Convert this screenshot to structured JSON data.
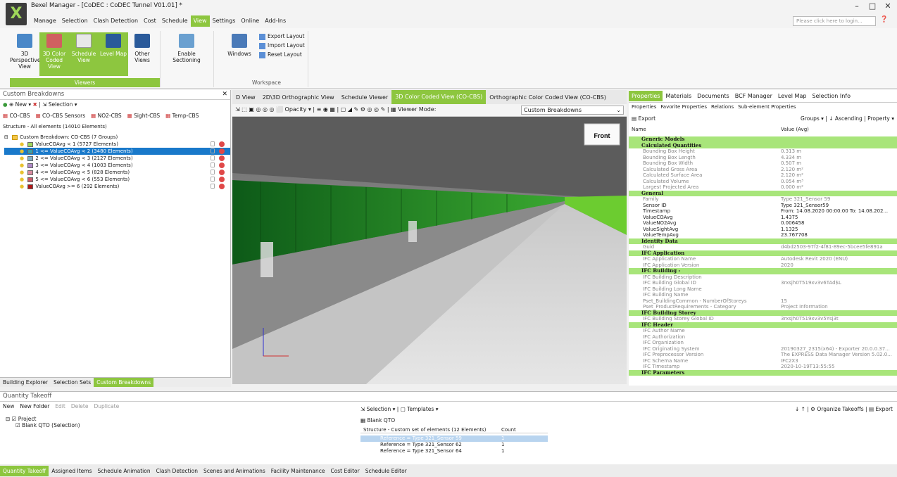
{
  "window": {
    "title": "Bexel Manager - [CoDEC : CoDEC Tunnel V01.01] *",
    "login_placeholder": "Please click here to login...",
    "min": "–",
    "max": "□",
    "close": "✕"
  },
  "menu": [
    "Manage",
    "Selection",
    "Clash Detection",
    "Cost",
    "Schedule",
    "View",
    "Settings",
    "Online",
    "Add-Ins"
  ],
  "ribbon": {
    "viewers": [
      {
        "label": "3D Perspective View"
      },
      {
        "label": "3D Color Coded View"
      },
      {
        "label": "Schedule View"
      },
      {
        "label": "Level Map"
      },
      {
        "label": "Other Views"
      },
      {
        "label": "Enable Sectioning"
      }
    ],
    "viewers_group": "Viewers",
    "windows_label": "Windows",
    "layout": [
      "Export Layout",
      "Import Layout",
      "Reset Layout"
    ],
    "workspace_group": "Workspace"
  },
  "left_panel": {
    "title": "Custom Breakdowns",
    "toolbar": "● ◆ | New ▾ | ✖ | Selection ▾",
    "new_label": "New",
    "selection_label": "Selection",
    "cbs_tabs": [
      "CO-CBS",
      "CO-CBS Sensors",
      "NO2-CBS",
      "Sight-CBS",
      "Temp-CBS"
    ],
    "structure_label": "Structure - All elements (14010 Elements)",
    "root": "Custom Breakdown: CO-CBS (7 Groups)",
    "items": [
      {
        "label": "ValueCOAvg < 1 (5727 Elements)",
        "color": "#9fd65a"
      },
      {
        "label": "1 <= ValueCOAvg < 2 (3480 Elements)",
        "color": "#3aa0a8"
      },
      {
        "label": "2 <= ValueCOAvg < 3 (2127 Elements)",
        "color": "#7fb0c8"
      },
      {
        "label": "3 <= ValueCOAvg < 4 (1003 Elements)",
        "color": "#b08ac8"
      },
      {
        "label": "4 <= ValueCOAvg < 5 (828 Elements)",
        "color": "#d88aa0"
      },
      {
        "label": "5 <= ValueCOAvg < 6 (553 Elements)",
        "color": "#c85a6a"
      },
      {
        "label": "ValueCOAvg >= 6 (292 Elements)",
        "color": "#b01818"
      }
    ],
    "tabs": [
      "Building Explorer",
      "Selection Sets",
      "Custom Breakdowns"
    ]
  },
  "view_tabs": [
    "D View",
    "2D\\3D Orthographic View",
    "Schedule Viewer",
    "3D Color Coded View (CO-CBS)",
    "Orthographic Color Coded View (CO-CBS)"
  ],
  "view_toolbar": {
    "opacity": "Opacity",
    "viewer_mode_label": "Viewer Mode:",
    "viewer_mode": "Custom Breakdowns",
    "front": "Front"
  },
  "right_panel": {
    "tabs": [
      "Properties",
      "Materials",
      "Documents",
      "BCF Manager",
      "Level Map",
      "Selection Info"
    ],
    "subtabs": [
      "Properties",
      "Favorite Properties",
      "Relations",
      "Sub-element Properties"
    ],
    "export": "Export",
    "groups": "Groups",
    "ascending": "Ascending",
    "property": "Property",
    "col_name": "Name",
    "col_value": "Value (Avg)",
    "rows": [
      {
        "cat": "Generic Models"
      },
      {
        "cat": "Calculated Quantities"
      },
      {
        "n": "Bounding Box Height",
        "v": "0.313 m"
      },
      {
        "n": "Bounding Box Length",
        "v": "4.334 m"
      },
      {
        "n": "Bounding Box Width",
        "v": "0.507 m"
      },
      {
        "n": "Calculated Gross Area",
        "v": "2.120 m²"
      },
      {
        "n": "Calculated Surface Area",
        "v": "2.120 m²"
      },
      {
        "n": "Calculated Volume",
        "v": "0.054 m³"
      },
      {
        "n": "Largest Projected Area",
        "v": "0.000 m²"
      },
      {
        "cat": "General"
      },
      {
        "n": "Family",
        "v": "Type 321_Sensor 59"
      },
      {
        "n": "Sensor ID",
        "v": "Type 321_Sensor59",
        "d": true
      },
      {
        "n": "Timestamp",
        "v": "From: 14.08.2020 00:00:00 To: 14.08.202...",
        "d": true
      },
      {
        "n": "ValueCOAvg",
        "v": "1.4375",
        "d": true
      },
      {
        "n": "ValueNO2Avg",
        "v": "0.006458",
        "d": true
      },
      {
        "n": "ValueSightAvg",
        "v": "1.1325",
        "d": true
      },
      {
        "n": "ValueTempAvg",
        "v": "23.767708",
        "d": true
      },
      {
        "cat": "Identity Data"
      },
      {
        "n": "Guid",
        "v": "d4bd2503-97f2-4f81-89ec-5bcee5fe891a"
      },
      {
        "cat": "IFC Application"
      },
      {
        "n": "IFC Application Name",
        "v": "Autodesk Revit 2020 (ENU)"
      },
      {
        "n": "IFC Application Version",
        "v": "2020"
      },
      {
        "cat": "IFC Building -"
      },
      {
        "n": "IFC Building Description",
        "v": ""
      },
      {
        "n": "IFC Building Global ID",
        "v": "3rxsjh0T519xv3v6TAd$L"
      },
      {
        "n": "IFC Building Long Name",
        "v": ""
      },
      {
        "n": "IFC Building Name",
        "v": ""
      },
      {
        "n": "Pset_BuildingCommon - NumberOfStoreys",
        "v": "15"
      },
      {
        "n": "Pset_ProductRequirements - Category",
        "v": "Project Information"
      },
      {
        "cat": "IFC Building Storey"
      },
      {
        "n": "IFC Building Storey Global ID",
        "v": "3rxsjh0T519xv3v5Ysj3t"
      },
      {
        "cat": "IFC Header"
      },
      {
        "n": "IFC Author Name",
        "v": ""
      },
      {
        "n": "IFC Authorization",
        "v": ""
      },
      {
        "n": "IFC Organization",
        "v": ""
      },
      {
        "n": "IFC Originating System",
        "v": "20190327_2315(x64) - Exporter 20.0.0.37..."
      },
      {
        "n": "IFC Preprocessor Version",
        "v": "The EXPRESS Data Manager Version 5.02.0..."
      },
      {
        "n": "IFC Schema Name",
        "v": "IFC2X3"
      },
      {
        "n": "IFC Timestamp",
        "v": "2020-10-19T13:55:55"
      },
      {
        "cat": "IFC Parameters"
      }
    ]
  },
  "qto": {
    "title": "Quantity Takeoff",
    "toolbar": [
      "New",
      "New Folder",
      "Edit",
      "Delete",
      "Duplicate"
    ],
    "tree": [
      "Project",
      "Blank QTO (Selection)"
    ],
    "mid_toolbar": [
      "Selection",
      "Templates"
    ],
    "blank_label": "Blank QTO",
    "col_structure": "Structure - Custom set of elements (12 Elements)",
    "col_count": "Count",
    "rows": [
      {
        "label": "Reference = Type 321_Sensor 59",
        "count": "1"
      },
      {
        "label": "Reference = Type 321_Sensor 62",
        "count": "1"
      },
      {
        "label": "Reference = Type 321_Sensor 64",
        "count": "1"
      }
    ],
    "organize": "Organize Takeoffs",
    "export": "Export"
  },
  "bottom_tabs": [
    "Quantity Takeoff",
    "Assigned Items",
    "Schedule Animation",
    "Clash Detection",
    "Scenes and Animations",
    "Facility Maintenance",
    "Cost Editor",
    "Schedule Editor"
  ]
}
